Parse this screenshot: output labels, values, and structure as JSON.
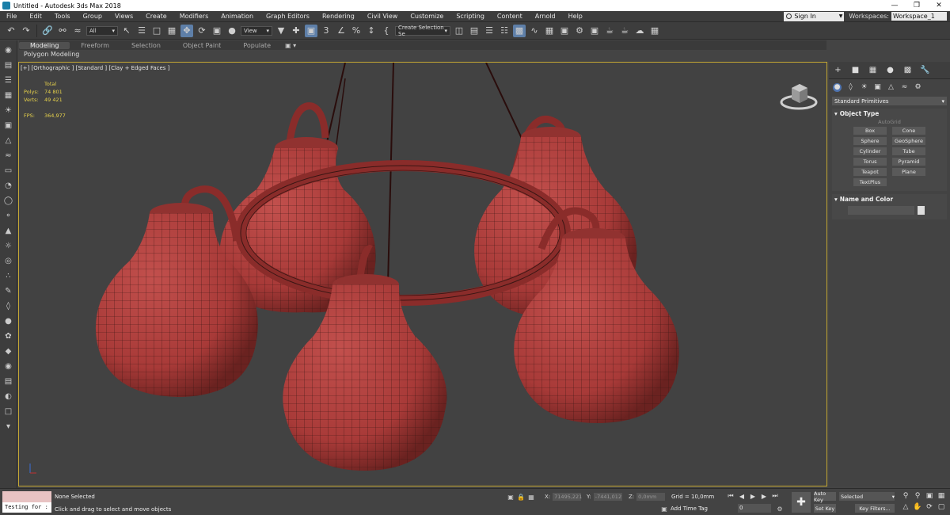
{
  "window": {
    "title": "Untitled - Autodesk 3ds Max 2018"
  },
  "menu": {
    "items": [
      "File",
      "Edit",
      "Tools",
      "Group",
      "Views",
      "Create",
      "Modifiers",
      "Animation",
      "Graph Editors",
      "Rendering",
      "Civil View",
      "Customize",
      "Scripting",
      "Content",
      "Arnold",
      "Help"
    ],
    "signin": "Sign In",
    "workspaces_label": "Workspaces:",
    "workspace_value": "Workspace_1"
  },
  "toolbar": {
    "filter_value": "All",
    "refcoord_value": "View",
    "selection_set_value": "Create Selection Se"
  },
  "ribbon": {
    "tabs": [
      "Modeling",
      "Freeform",
      "Selection",
      "Object Paint",
      "Populate"
    ],
    "active_tab": "Modeling",
    "sub_label": "Polygon Modeling"
  },
  "viewport": {
    "label": "[+] [Orthographic ] [Standard ] [Clay + Edged Faces ]",
    "stats_total": "Total",
    "polys_label": "Polys:",
    "polys_value": "74 801",
    "verts_label": "Verts:",
    "verts_value": "49 421",
    "fps_label": "FPS:",
    "fps_value": "364,977"
  },
  "command_panel": {
    "category": "Standard Primitives",
    "object_type_title": "Object Type",
    "autogrid": "AutoGrid",
    "buttons": [
      "Box",
      "Cone",
      "Sphere",
      "GeoSphere",
      "Cylinder",
      "Tube",
      "Torus",
      "Pyramid",
      "Teapot",
      "Plane",
      "TextPlus"
    ],
    "name_color_title": "Name and Color"
  },
  "status": {
    "maxscript_output": "Testing for :",
    "selection": "None Selected",
    "prompt": "Click and drag to select and move objects",
    "x_label": "X:",
    "x_value": "71495,221",
    "y_label": "Y:",
    "y_value": "-7441,012",
    "z_label": "Z:",
    "z_value": "0,0mm",
    "grid": "Grid = 10,0mm",
    "add_time_tag": "Add Time Tag",
    "frame_value": "0",
    "auto_key": "Auto Key",
    "set_key": "Set Key",
    "selected_value": "Selected",
    "key_filters": "Key Filters..."
  },
  "colors": {
    "model": "#a83a38",
    "viewport_bg": "#424242",
    "active_border": "#c4a733",
    "stats_text": "#e7d24b",
    "accent": "#5e7fa8"
  }
}
